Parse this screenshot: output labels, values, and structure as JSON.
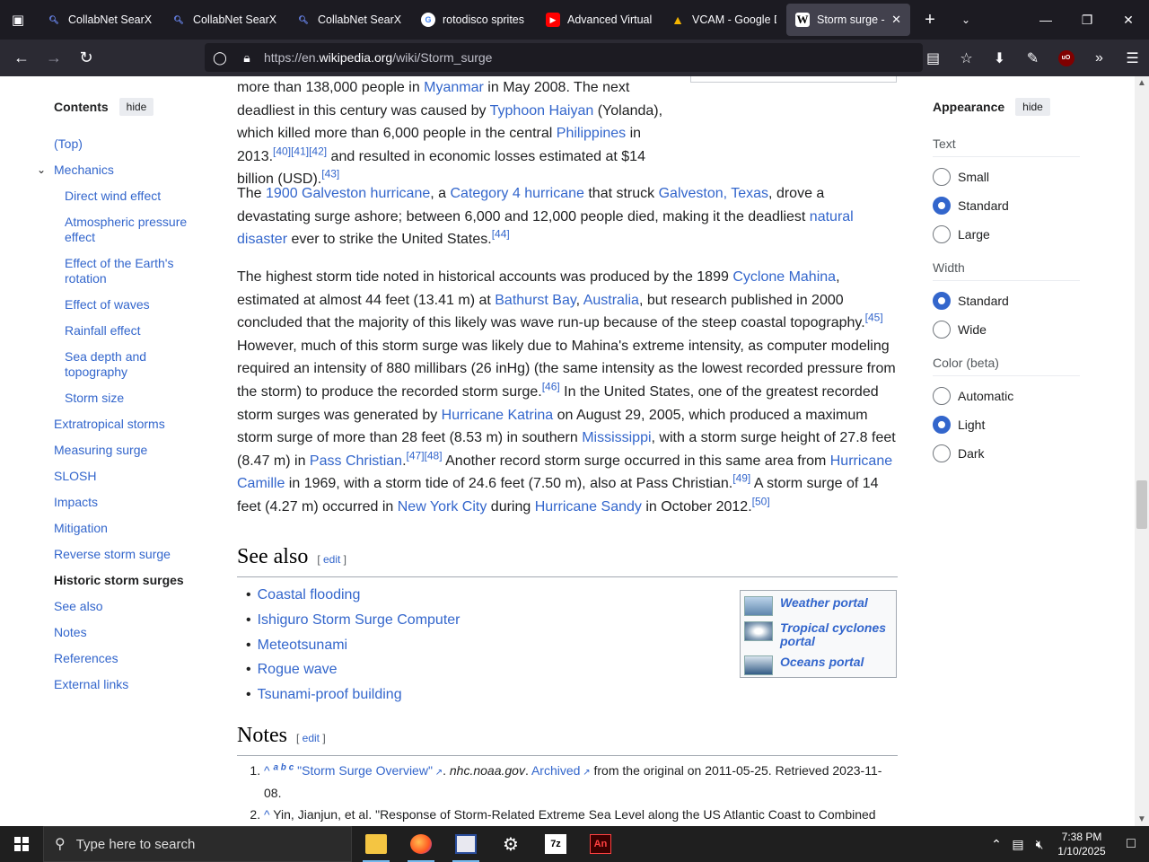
{
  "browser": {
    "tabs": [
      {
        "title": "CollabNet SearXNG",
        "icon": "search-icon"
      },
      {
        "title": "CollabNet SearXNG",
        "icon": "search-icon"
      },
      {
        "title": "CollabNet SearXNG",
        "icon": "search-icon"
      },
      {
        "title": "rotodisco sprites s",
        "icon": "google-icon"
      },
      {
        "title": "Advanced Virtual C",
        "icon": "youtube-icon"
      },
      {
        "title": "VCAM - Google Dr",
        "icon": "google-drive-icon"
      },
      {
        "title": "Storm surge - Wikipedia",
        "icon": "wikipedia-icon",
        "active": true
      }
    ],
    "url_prefix": "https://en.",
    "url_domain": "wikipedia.org",
    "url_path": "/wiki/Storm_surge"
  },
  "toc": {
    "heading": "Contents",
    "hide": "hide",
    "items": [
      {
        "label": "(Top)"
      },
      {
        "label": "Mechanics"
      },
      {
        "label": "Direct wind effect"
      },
      {
        "label": "Atmospheric pressure effect"
      },
      {
        "label": "Effect of the Earth's rotation"
      },
      {
        "label": "Effect of waves"
      },
      {
        "label": "Rainfall effect"
      },
      {
        "label": "Sea depth and topography"
      },
      {
        "label": "Storm size"
      },
      {
        "label": "Extratropical storms"
      },
      {
        "label": "Measuring surge"
      },
      {
        "label": "SLOSH"
      },
      {
        "label": "Impacts"
      },
      {
        "label": "Mitigation"
      },
      {
        "label": "Reverse storm surge"
      },
      {
        "label": "Historic storm surges"
      },
      {
        "label": "See also"
      },
      {
        "label": "Notes"
      },
      {
        "label": "References"
      },
      {
        "label": "External links"
      }
    ]
  },
  "article": {
    "p1": {
      "t1": "more than 138,000 people in ",
      "l1": "Myanmar",
      "t2": " in May 2008. The next deadliest in this century was caused by ",
      "l2": "Typhoon Haiyan",
      "t3": " (Yolanda), which killed more than 6,000 people in the central ",
      "l3": "Philippines",
      "t4": " in 2013.",
      "r1": "[40][41][42]",
      "t5": " and resulted in economic losses estimated at $14 billion (USD).",
      "r2": "[43]"
    },
    "p2": {
      "t1": "The ",
      "l1": "1900 Galveston hurricane",
      "t2": ", a ",
      "l2": "Category 4 hurricane",
      "t3": " that struck ",
      "l3": "Galveston, Texas",
      "t4": ", drove a devastating surge ashore; between 6,000 and 12,000 people died, making it the deadliest ",
      "l4": "natural disaster",
      "t5": " ever to strike the United States.",
      "r1": "[44]"
    },
    "p3": {
      "t1": "The highest storm tide noted in historical accounts was produced by the 1899 ",
      "l1": "Cyclone Mahina",
      "t2": ", estimated at almost 44 feet (13.41 m) at ",
      "l2": "Bathurst Bay",
      "t3": ", ",
      "l3": "Australia",
      "t4": ", but research published in 2000 concluded that the majority of this likely was wave run-up because of the steep coastal topography.",
      "r1": "[45]",
      "t5": " However, much of this storm surge was likely due to Mahina's extreme intensity, as computer modeling required an intensity of 880 millibars (26 inHg) (the same intensity as the lowest recorded pressure from the storm) to produce the recorded storm surge.",
      "r2": "[46]",
      "t6": " In the United States, one of the greatest recorded storm surges was generated by ",
      "l4": "Hurricane Katrina",
      "t7": " on August 29, 2005, which produced a maximum storm surge of more than 28 feet (8.53 m) in southern ",
      "l5": "Mississippi",
      "t8": ", with a storm surge height of 27.8 feet (8.47 m) in ",
      "l6": "Pass Christian",
      "t9": ".",
      "r3": "[47][48]",
      "t10": " Another record storm surge occurred in this same area from ",
      "l7": "Hurricane Camille",
      "t11": " in 1969, with a storm tide of 24.6 feet (7.50 m), also at Pass Christian.",
      "r4": "[49]",
      "t12": " A storm surge of 14 feet (4.27 m) occurred in ",
      "l8": "New York City",
      "t13": " during ",
      "l9": "Hurricane Sandy",
      "t14": " in October 2012.",
      "r5": "[50]"
    },
    "see_also": {
      "heading": "See also",
      "edit": "edit",
      "items": [
        "Coastal flooding",
        "Ishiguro Storm Surge Computer",
        "Meteotsunami",
        "Rogue wave",
        "Tsunami-proof building"
      ],
      "portals": [
        "Weather portal",
        "Tropical cyclones portal",
        "Oceans portal"
      ]
    },
    "notes": {
      "heading": "Notes",
      "edit": "edit",
      "n1": {
        "caret": "^",
        "abc": "a b c",
        "title": "\"Storm Surge Overview\"",
        "site": "nhc.noaa.gov",
        "archived": "Archived",
        "rest": " from the original on 2011-05-25. Retrieved 2023-11-08."
      },
      "n2": {
        "caret": "^",
        "text": "Yin, Jianjun, et al. \"Response of Storm-Related Extreme Sea Level along the US Atlantic Coast to Combined"
      }
    }
  },
  "appearance": {
    "heading": "Appearance",
    "hide": "hide",
    "text_label": "Text",
    "text_options": [
      "Small",
      "Standard",
      "Large"
    ],
    "text_selected": "Standard",
    "width_label": "Width",
    "width_options": [
      "Standard",
      "Wide"
    ],
    "width_selected": "Standard",
    "color_label": "Color (beta)",
    "color_options": [
      "Automatic",
      "Light",
      "Dark"
    ],
    "color_selected": "Light"
  },
  "taskbar": {
    "search_placeholder": "Type here to search",
    "time": "7:38 PM",
    "date": "1/10/2025",
    "apps": [
      "file-explorer-icon",
      "firefox-icon",
      "image-editor-icon",
      "gear-icon",
      "7zip-icon",
      "adobe-animate-icon"
    ]
  }
}
